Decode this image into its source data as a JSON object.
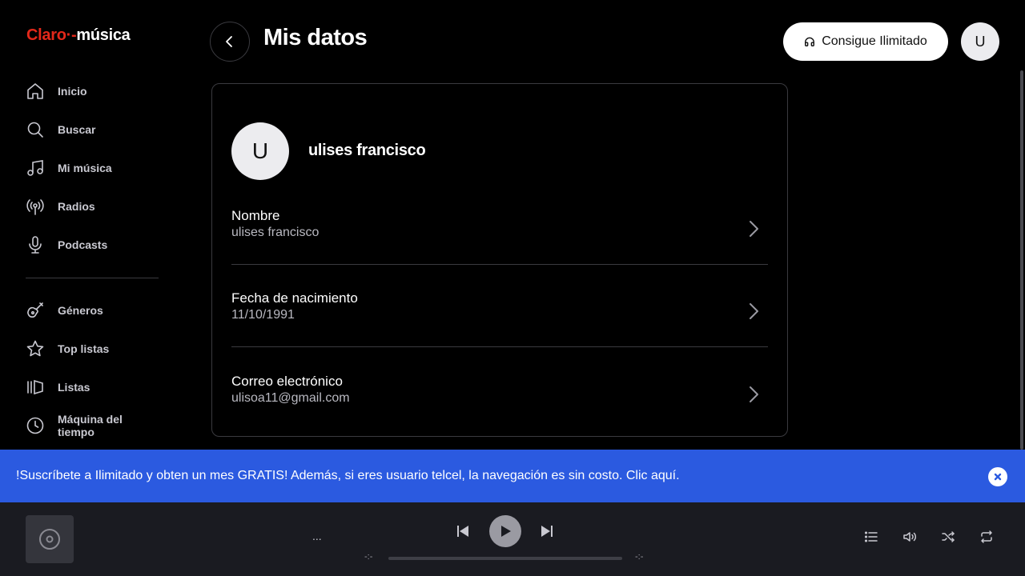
{
  "logo": {
    "claro": "Claro",
    "musica": "música"
  },
  "sidebar": {
    "items": [
      {
        "label": "Inicio",
        "icon": "home-icon"
      },
      {
        "label": "Buscar",
        "icon": "search-icon"
      },
      {
        "label": "Mi música",
        "icon": "music-note-icon"
      },
      {
        "label": "Radios",
        "icon": "radio-icon"
      },
      {
        "label": "Podcasts",
        "icon": "microphone-icon"
      }
    ],
    "items2": [
      {
        "label": "Géneros",
        "icon": "guitar-icon"
      },
      {
        "label": "Top listas",
        "icon": "star-icon"
      },
      {
        "label": "Listas",
        "icon": "playlist-icon"
      },
      {
        "label": "Máquina del tiempo",
        "icon": "clock-icon"
      }
    ]
  },
  "header": {
    "title": "Mis datos",
    "premium_label": "Consigue Ilimitado",
    "avatar_initial": "U"
  },
  "profile": {
    "initial": "U",
    "name": "ulises francisco",
    "fields": [
      {
        "label": "Nombre",
        "value": "ulises francisco"
      },
      {
        "label": "Fecha de nacimiento",
        "value": "11/10/1991"
      },
      {
        "label": "Correo electrónico",
        "value": "ulisoa11@gmail.com"
      }
    ]
  },
  "banner": {
    "text": "!Suscríbete a Ilimitado y obten un mes GRATIS! Además, si eres usuario telcel, la navegación es sin costo. Clic aquí."
  },
  "player": {
    "track_placeholder": "...",
    "time_elapsed": "-:-",
    "time_total": "-:-",
    "progress": 0
  },
  "colors": {
    "brand_red": "#e4281a",
    "banner_blue": "#2b5ae0",
    "player_bg": "#1a1b21"
  }
}
